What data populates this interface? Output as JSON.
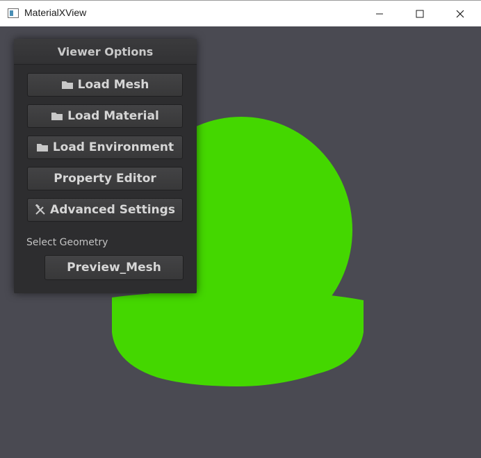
{
  "window": {
    "title": "MaterialXView",
    "controls": {
      "minimize": "minimize-icon",
      "maximize": "maximize-icon",
      "close": "close-icon"
    }
  },
  "colors": {
    "viewport_bg": "#4a4a52",
    "preview_green": "#44d700",
    "panel_bg": "#2d2d2f",
    "button_text": "#d6d6d6"
  },
  "panel": {
    "title": "Viewer Options",
    "buttons": [
      {
        "label": "Load Mesh",
        "icon": "folder-icon"
      },
      {
        "label": "Load Material",
        "icon": "folder-icon"
      },
      {
        "label": "Load Environment",
        "icon": "folder-icon"
      },
      {
        "label": "Property Editor",
        "icon": ""
      },
      {
        "label": "Advanced Settings",
        "icon": "tools-icon"
      }
    ],
    "geometry": {
      "label": "Select Geometry",
      "selected": "Preview_Mesh"
    }
  }
}
